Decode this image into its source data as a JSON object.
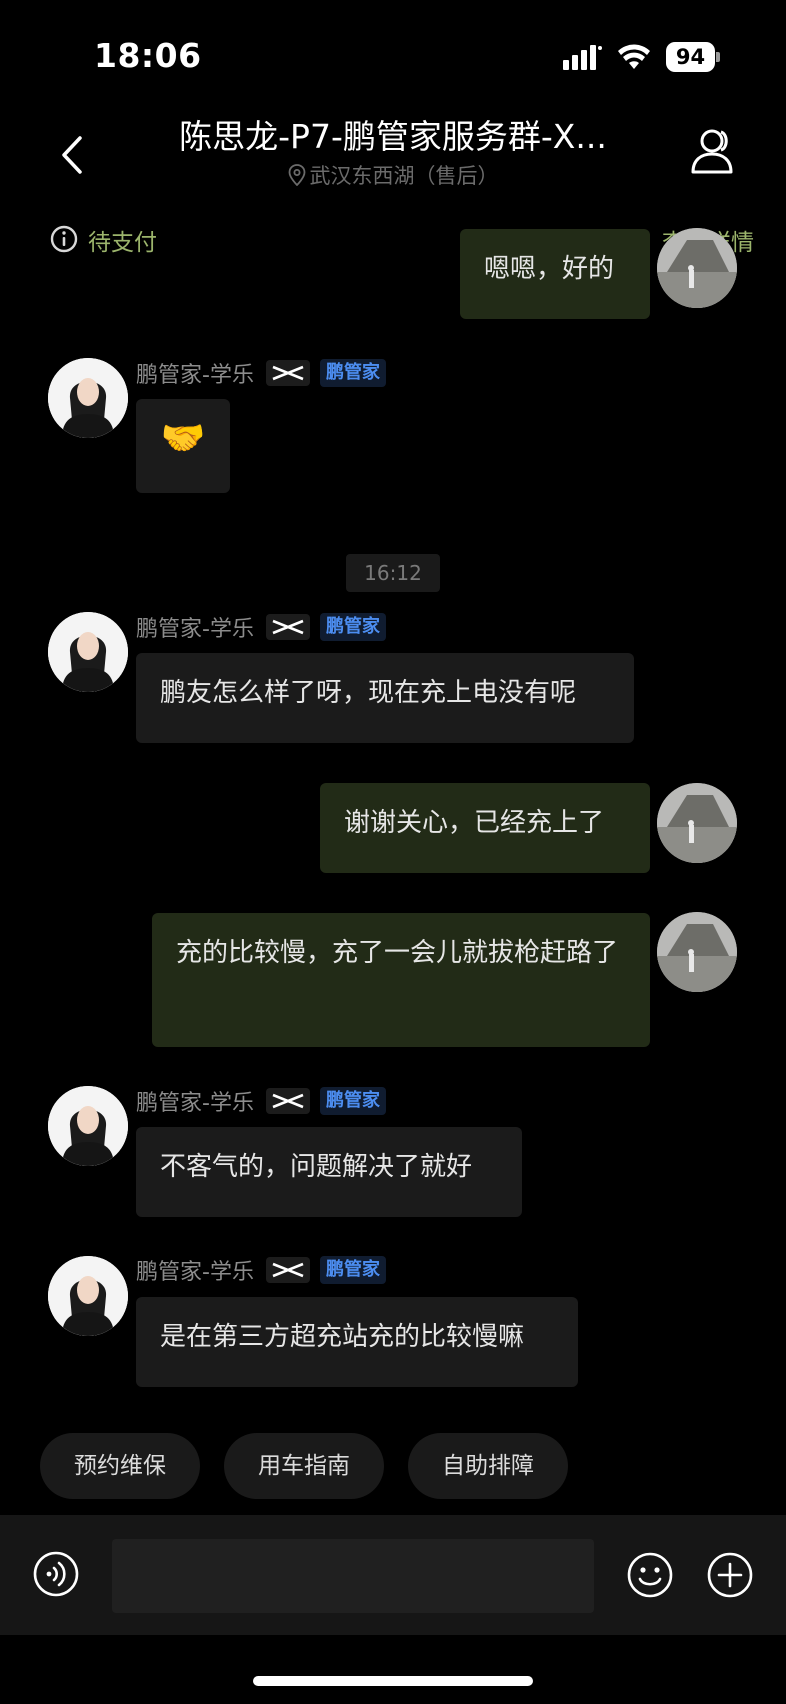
{
  "status_bar": {
    "time": "18:06",
    "battery": "94"
  },
  "header": {
    "title": "陈思龙-P7-鹏管家服务群-X...",
    "subtitle": "武汉东西湖（售后）"
  },
  "pending": {
    "label": "待支付",
    "detail_link": "查看详情"
  },
  "messages": [
    {
      "side": "user",
      "text": "嗯嗯，好的"
    },
    {
      "side": "agent",
      "sender": "鹏管家-学乐",
      "badge": "鹏管家",
      "text": "🤝"
    },
    {
      "side": "agent",
      "sender": "鹏管家-学乐",
      "badge": "鹏管家",
      "text": "鹏友怎么样了呀，现在充上电没有呢"
    },
    {
      "side": "user",
      "text": "谢谢关心，已经充上了"
    },
    {
      "side": "user",
      "text": "充的比较慢，充了一会儿就拔枪赶路了"
    },
    {
      "side": "agent",
      "sender": "鹏管家-学乐",
      "badge": "鹏管家",
      "text": "不客气的，问题解决了就好"
    },
    {
      "side": "agent",
      "sender": "鹏管家-学乐",
      "badge": "鹏管家",
      "text": "是在第三方超充站充的比较慢嘛"
    }
  ],
  "time_divider": "16:12",
  "quick_actions": [
    "预约维保",
    "用车指南",
    "自助排障"
  ],
  "input": {
    "placeholder": ""
  },
  "icons": {
    "back": "chevron-left-icon",
    "members": "person-icon",
    "info": "info-circle-icon",
    "voice": "voice-icon",
    "emoji": "smiley-icon",
    "plus": "plus-circle-icon"
  },
  "colors": {
    "accent_green": "#9cb56c",
    "badge_blue": "#4c8df0",
    "user_bubble": "#222b17",
    "agent_bubble": "#1b1b1b"
  }
}
